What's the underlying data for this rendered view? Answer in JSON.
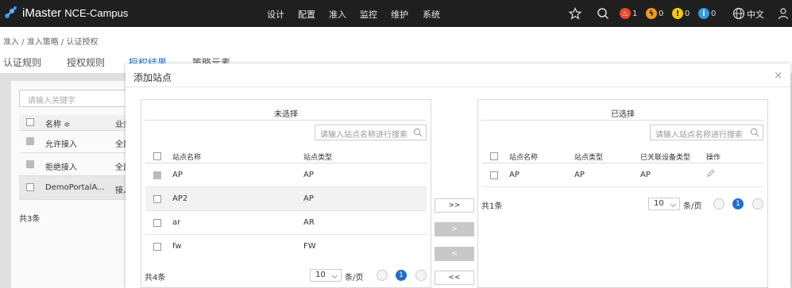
{
  "app": {
    "brand": "iMaster",
    "product": "NCE-Campus"
  },
  "nav": [
    "设计",
    "配置",
    "准入",
    "监控",
    "维护",
    "系统"
  ],
  "alarms": [
    {
      "name": "critical",
      "count": "1",
      "color": "#e8452c"
    },
    {
      "name": "major",
      "count": "0",
      "color": "#f39a1e"
    },
    {
      "name": "minor",
      "count": "0",
      "color": "#f2c811"
    },
    {
      "name": "info",
      "count": "0",
      "color": "#2f9be8"
    }
  ],
  "lang": "中文",
  "breadcrumb": "准入 / 准入策略 / 认证授权",
  "tabs": [
    "认证规则",
    "授权规则",
    "授权结果",
    "策略元素"
  ],
  "background": {
    "search_placeholder": "请输入关键字",
    "col_name": "名称 ≑",
    "col_type": "业务",
    "rows": [
      {
        "name": "允许接入",
        "type": "全部"
      },
      {
        "name": "拒绝接入",
        "type": "全部"
      },
      {
        "name": "DemoPortalA...",
        "type": "接入"
      }
    ],
    "total": "共3条"
  },
  "dialog": {
    "title": "添加站点",
    "close": "×",
    "left": {
      "title": "未选择",
      "search_placeholder": "请输入站点名称进行搜索",
      "headers": [
        "站点名称",
        "站点类型"
      ],
      "rows": [
        {
          "name": "AP",
          "type": "AP",
          "disabled": true
        },
        {
          "name": "AP2",
          "type": "AP",
          "selected": true
        },
        {
          "name": "ar",
          "type": "AR"
        },
        {
          "name": "fw",
          "type": "FW"
        }
      ],
      "total": "共4条",
      "page_size": "10",
      "per_page": "条/页",
      "page": "1"
    },
    "buttons": [
      ">>",
      ">",
      "<",
      "<<"
    ],
    "right": {
      "title": "已选择",
      "search_placeholder": "请输入站点名称进行搜索",
      "headers": [
        "站点名称",
        "站点类型",
        "已关联设备类型",
        "操作"
      ],
      "rows": [
        {
          "name": "AP",
          "type": "AP",
          "device_type": "AP"
        }
      ],
      "total": "共1条",
      "page_size": "10",
      "per_page": "条/页",
      "page": "1"
    }
  }
}
